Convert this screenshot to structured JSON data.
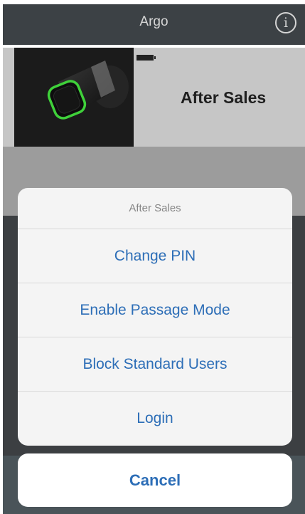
{
  "navbar": {
    "title": "Argo",
    "info_icon": "info-icon",
    "info_glyph": "i"
  },
  "device": {
    "name": "After Sales",
    "image": "smart-lock-cylinder-image",
    "battery_icon": "battery-icon"
  },
  "action_sheet": {
    "header": "After Sales",
    "items": [
      {
        "label": "Change PIN"
      },
      {
        "label": "Enable Passage Mode"
      },
      {
        "label": "Block Standard Users"
      },
      {
        "label": "Login"
      }
    ],
    "cancel_label": "Cancel"
  },
  "colors": {
    "accent": "#2d6eb7",
    "navbar": "#3c4145",
    "sheet_background": "#f4f4f4",
    "ring_green": "#3fd13a"
  }
}
